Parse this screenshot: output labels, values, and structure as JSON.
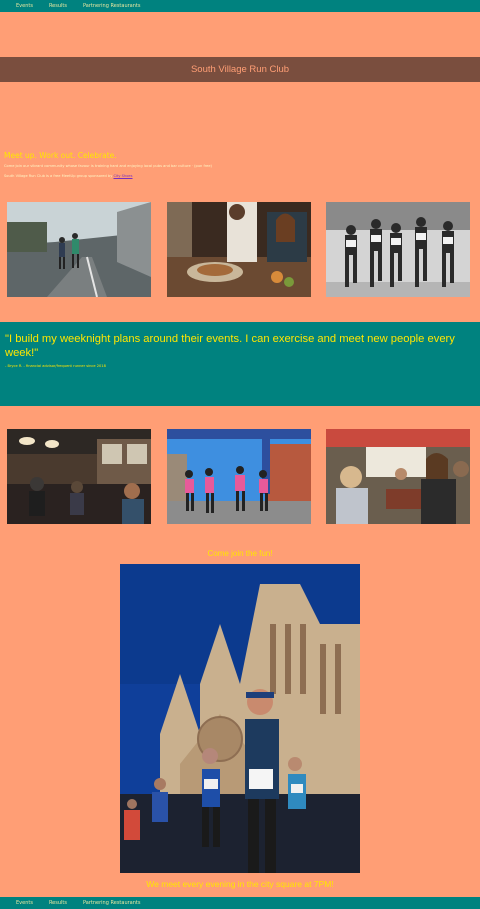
{
  "nav": {
    "items": [
      "Events",
      "Results",
      "Partnering Restaurants"
    ]
  },
  "hero": {
    "title": "South Village Run Club"
  },
  "intro": {
    "tagline": "Meet up. Work out. Celebrate.",
    "paragraph1": "Come join our vibrant community whose favour is training hard and enjoying local pubs and bar culture · (pun free)",
    "paragraph2_prefix": "South Village Run Club is a free MeetUp group sponsored by ",
    "sponsor_link": "City Shoes"
  },
  "testimonial": {
    "quote": "\"I build my weeknight plans around their events. I can exercise and meet new people every week!\"",
    "attribution": "- Bryce R. - financial advisor/frequent runner since 2018"
  },
  "cta": {
    "join": "Come join the fun!",
    "schedule": "We meet every evening in the city square at 7PM!"
  },
  "photos": {
    "row1": [
      "runners-tunnel-photo",
      "pub-food-photo",
      "race-runners-bw-photo"
    ],
    "row2": [
      "pub-interior-photo",
      "finish-line-photo",
      "dining-group-photo"
    ],
    "feature": "cathedral-runners-photo"
  },
  "colors": {
    "background": "#FF9E75",
    "nav": "#00827F",
    "hero_band": "#7A4E3E",
    "accent_text": "#FFE600"
  }
}
